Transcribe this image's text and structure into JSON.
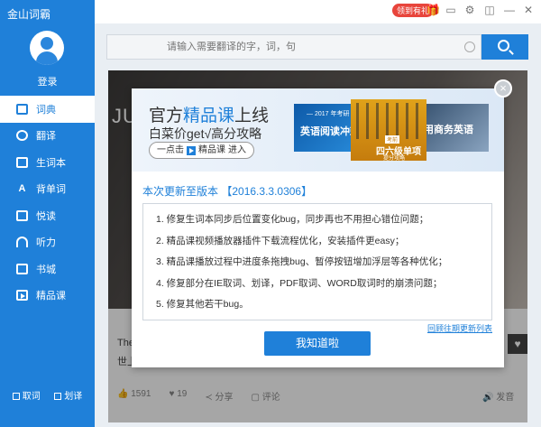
{
  "app": {
    "title": "金山词霸"
  },
  "sidebar": {
    "login_label": "登录",
    "items": [
      {
        "label": "词典",
        "icon": "book-icon",
        "active": true
      },
      {
        "label": "翻译",
        "icon": "translate-icon"
      },
      {
        "label": "生词本",
        "icon": "notebook-icon"
      },
      {
        "label": "背单词",
        "icon": "flashcard-icon"
      },
      {
        "label": "悦读",
        "icon": "reading-icon"
      },
      {
        "label": "听力",
        "icon": "headphone-icon"
      },
      {
        "label": "书城",
        "icon": "bookstore-icon"
      },
      {
        "label": "精品课",
        "icon": "course-play-icon"
      }
    ],
    "footer": {
      "fetch_label": "取词",
      "select_label": "划译"
    }
  },
  "topbar": {
    "badge": "领到有礼"
  },
  "search": {
    "placeholder": "请输入需要翻译的字，词，句"
  },
  "card": {
    "image_text": "JU",
    "text_line1": "The",
    "text_line2": "世上",
    "likes": "1591",
    "hearts": "19",
    "share": "分享",
    "comment": "评论",
    "voice": "发音"
  },
  "dialog": {
    "banner": {
      "title_prefix": "官方",
      "title_highlight": "精品课",
      "title_suffix": "上线",
      "subtitle": "白菜价get√高分攻略",
      "button_prefix": "一点击",
      "button_name": "精品课",
      "button_suffix": "进入",
      "promo1_small": "— 2017 年考研 —",
      "promo1_text": "英语阅读冲刺",
      "promo2_tag": "考前",
      "promo2_text": "四六级单项",
      "promo2_sub": "提分攻略",
      "promo3_text": "用商务英语"
    },
    "version_prefix": "本次更新至版本",
    "version": "【2016.3.3.0306】",
    "notes": [
      "1.   修复生词本同步后位置变化bug，同步再也不用担心错位问题；",
      "2.   精品课视频播放器插件下载流程优化，安装插件更easy；",
      "3.   精品课播放过程中进度条拖拽bug、暂停按钮增加浮层等各种优化；",
      "4.   修复部分在IE取词、划译，PDF取词、WORD取词时的崩溃问题；",
      "5.   修复其他若干bug。"
    ],
    "history_link": "回顾往期更新列表",
    "ok_button": "我知道啦"
  },
  "colors": {
    "primary": "#1f80d9",
    "badge": "#e8453c"
  }
}
